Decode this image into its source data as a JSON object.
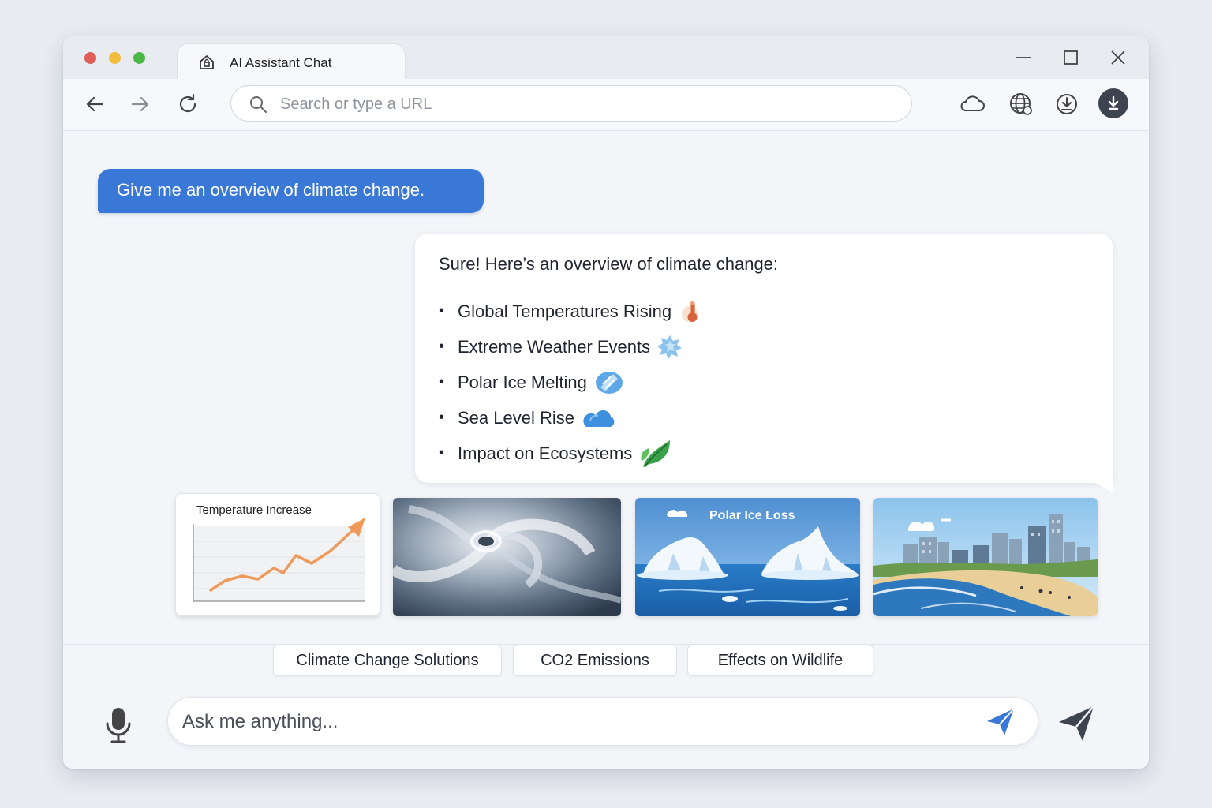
{
  "tab": {
    "title": "AI Assistant Chat"
  },
  "urlbar": {
    "placeholder": "Search or type a URL"
  },
  "chat": {
    "user_message": "Give me an overview of climate change.",
    "assistant_intro": "Sure! Here’s an overview of climate change:",
    "bullets": [
      {
        "label": "Global Temperatures Rising",
        "icon": "thermometer-icon"
      },
      {
        "label": "Extreme Weather Events",
        "icon": "storm-icon"
      },
      {
        "label": "Polar Ice Melting",
        "icon": "ice-icon"
      },
      {
        "label": "Sea Level Rise",
        "icon": "cloud-icon"
      },
      {
        "label": "Impact on Ecosystems",
        "icon": "leaf-icon"
      }
    ]
  },
  "media": {
    "chart_title": "Temperature Increase",
    "polar_label": "Polar Ice Loss"
  },
  "suggestions": [
    "Climate Change Solutions",
    "CO2 Emissions",
    "Effects on Wildlife"
  ],
  "input": {
    "placeholder": "Ask me anything..."
  },
  "colors": {
    "accent": "#3a78d8",
    "chart_line": "#ef9a5a",
    "leaf": "#3aa14a"
  }
}
